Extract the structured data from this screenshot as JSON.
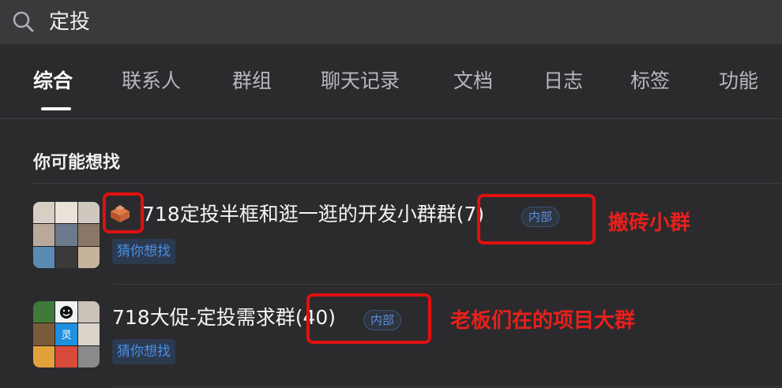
{
  "search": {
    "query": "定投"
  },
  "tabs": [
    {
      "label": "综合",
      "active": true
    },
    {
      "label": "联系人"
    },
    {
      "label": "群组"
    },
    {
      "label": "聊天记录"
    },
    {
      "label": "文档"
    },
    {
      "label": "日志"
    },
    {
      "label": "标签"
    },
    {
      "label": "功能"
    }
  ],
  "section": {
    "title": "你可能想找"
  },
  "results": [
    {
      "name": "718定投半框和逛一逛的开发小群群(7)",
      "badge": "内部",
      "tag": "猜你想找",
      "annotation": "搬砖小群"
    },
    {
      "name": "718大促-定投需求群(40)",
      "badge": "内部",
      "tag": "猜你想找",
      "annotation": "老板们在的项目大群",
      "avatar_char": "灵"
    }
  ],
  "colors": {
    "background": "#2b2b2e",
    "search_bar": "#3a3a3d",
    "accent_blue": "#4a8fe8",
    "annotation_red": "#e01010"
  }
}
